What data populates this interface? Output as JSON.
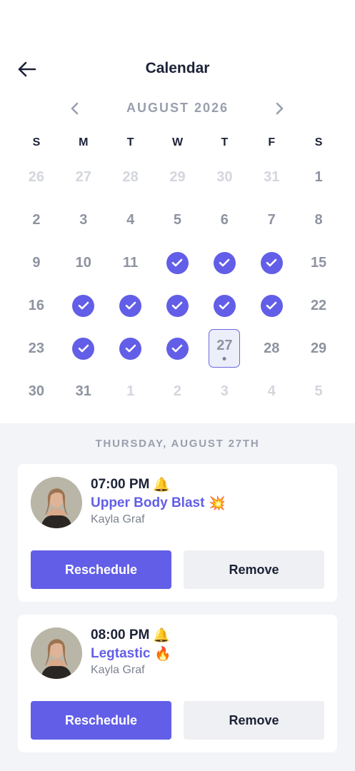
{
  "header": {
    "title": "Calendar",
    "back_icon": "arrow-left-icon"
  },
  "month_nav": {
    "label": "AUGUST 2026",
    "prev_icon": "chevron-left-icon",
    "next_icon": "chevron-right-icon"
  },
  "weekdays": [
    "S",
    "M",
    "T",
    "W",
    "T",
    "F",
    "S"
  ],
  "days": [
    {
      "label": "26",
      "state": "muted"
    },
    {
      "label": "27",
      "state": "muted"
    },
    {
      "label": "28",
      "state": "muted"
    },
    {
      "label": "29",
      "state": "muted"
    },
    {
      "label": "30",
      "state": "muted"
    },
    {
      "label": "31",
      "state": "muted"
    },
    {
      "label": "1",
      "state": "normal"
    },
    {
      "label": "2",
      "state": "normal"
    },
    {
      "label": "3",
      "state": "normal"
    },
    {
      "label": "4",
      "state": "normal"
    },
    {
      "label": "5",
      "state": "normal"
    },
    {
      "label": "6",
      "state": "normal"
    },
    {
      "label": "7",
      "state": "normal"
    },
    {
      "label": "8",
      "state": "normal"
    },
    {
      "label": "9",
      "state": "normal"
    },
    {
      "label": "10",
      "state": "normal"
    },
    {
      "label": "11",
      "state": "normal"
    },
    {
      "label": "12",
      "state": "completed"
    },
    {
      "label": "13",
      "state": "completed"
    },
    {
      "label": "14",
      "state": "completed"
    },
    {
      "label": "15",
      "state": "normal"
    },
    {
      "label": "16",
      "state": "normal"
    },
    {
      "label": "17",
      "state": "completed"
    },
    {
      "label": "18",
      "state": "completed"
    },
    {
      "label": "19",
      "state": "completed"
    },
    {
      "label": "20",
      "state": "completed"
    },
    {
      "label": "21",
      "state": "completed"
    },
    {
      "label": "22",
      "state": "normal"
    },
    {
      "label": "23",
      "state": "normal"
    },
    {
      "label": "24",
      "state": "completed"
    },
    {
      "label": "25",
      "state": "completed"
    },
    {
      "label": "26",
      "state": "completed"
    },
    {
      "label": "27",
      "state": "selected"
    },
    {
      "label": "28",
      "state": "normal"
    },
    {
      "label": "29",
      "state": "normal"
    },
    {
      "label": "30",
      "state": "normal"
    },
    {
      "label": "31",
      "state": "normal"
    },
    {
      "label": "1",
      "state": "muted"
    },
    {
      "label": "2",
      "state": "muted"
    },
    {
      "label": "3",
      "state": "muted"
    },
    {
      "label": "4",
      "state": "muted"
    },
    {
      "label": "5",
      "state": "muted"
    }
  ],
  "schedule": {
    "date_label": "THURSDAY, AUGUST 27TH",
    "workouts": [
      {
        "time": "07:00 PM",
        "time_emoji": "🔔",
        "name": "Upper Body Blast",
        "name_emoji": "💥",
        "trainer": "Kayla Graf",
        "reschedule_label": "Reschedule",
        "remove_label": "Remove"
      },
      {
        "time": "08:00 PM",
        "time_emoji": "🔔",
        "name": "Legtastic",
        "name_emoji": "🔥",
        "trainer": "Kayla Graf",
        "reschedule_label": "Reschedule",
        "remove_label": "Remove"
      }
    ]
  },
  "colors": {
    "accent": "#625ee7",
    "text_dark": "#1c2236",
    "text_muted": "#8e93a1",
    "text_faded": "#d3d6dd",
    "panel_bg": "#f3f4f7",
    "selected_bg": "#eceefa"
  }
}
